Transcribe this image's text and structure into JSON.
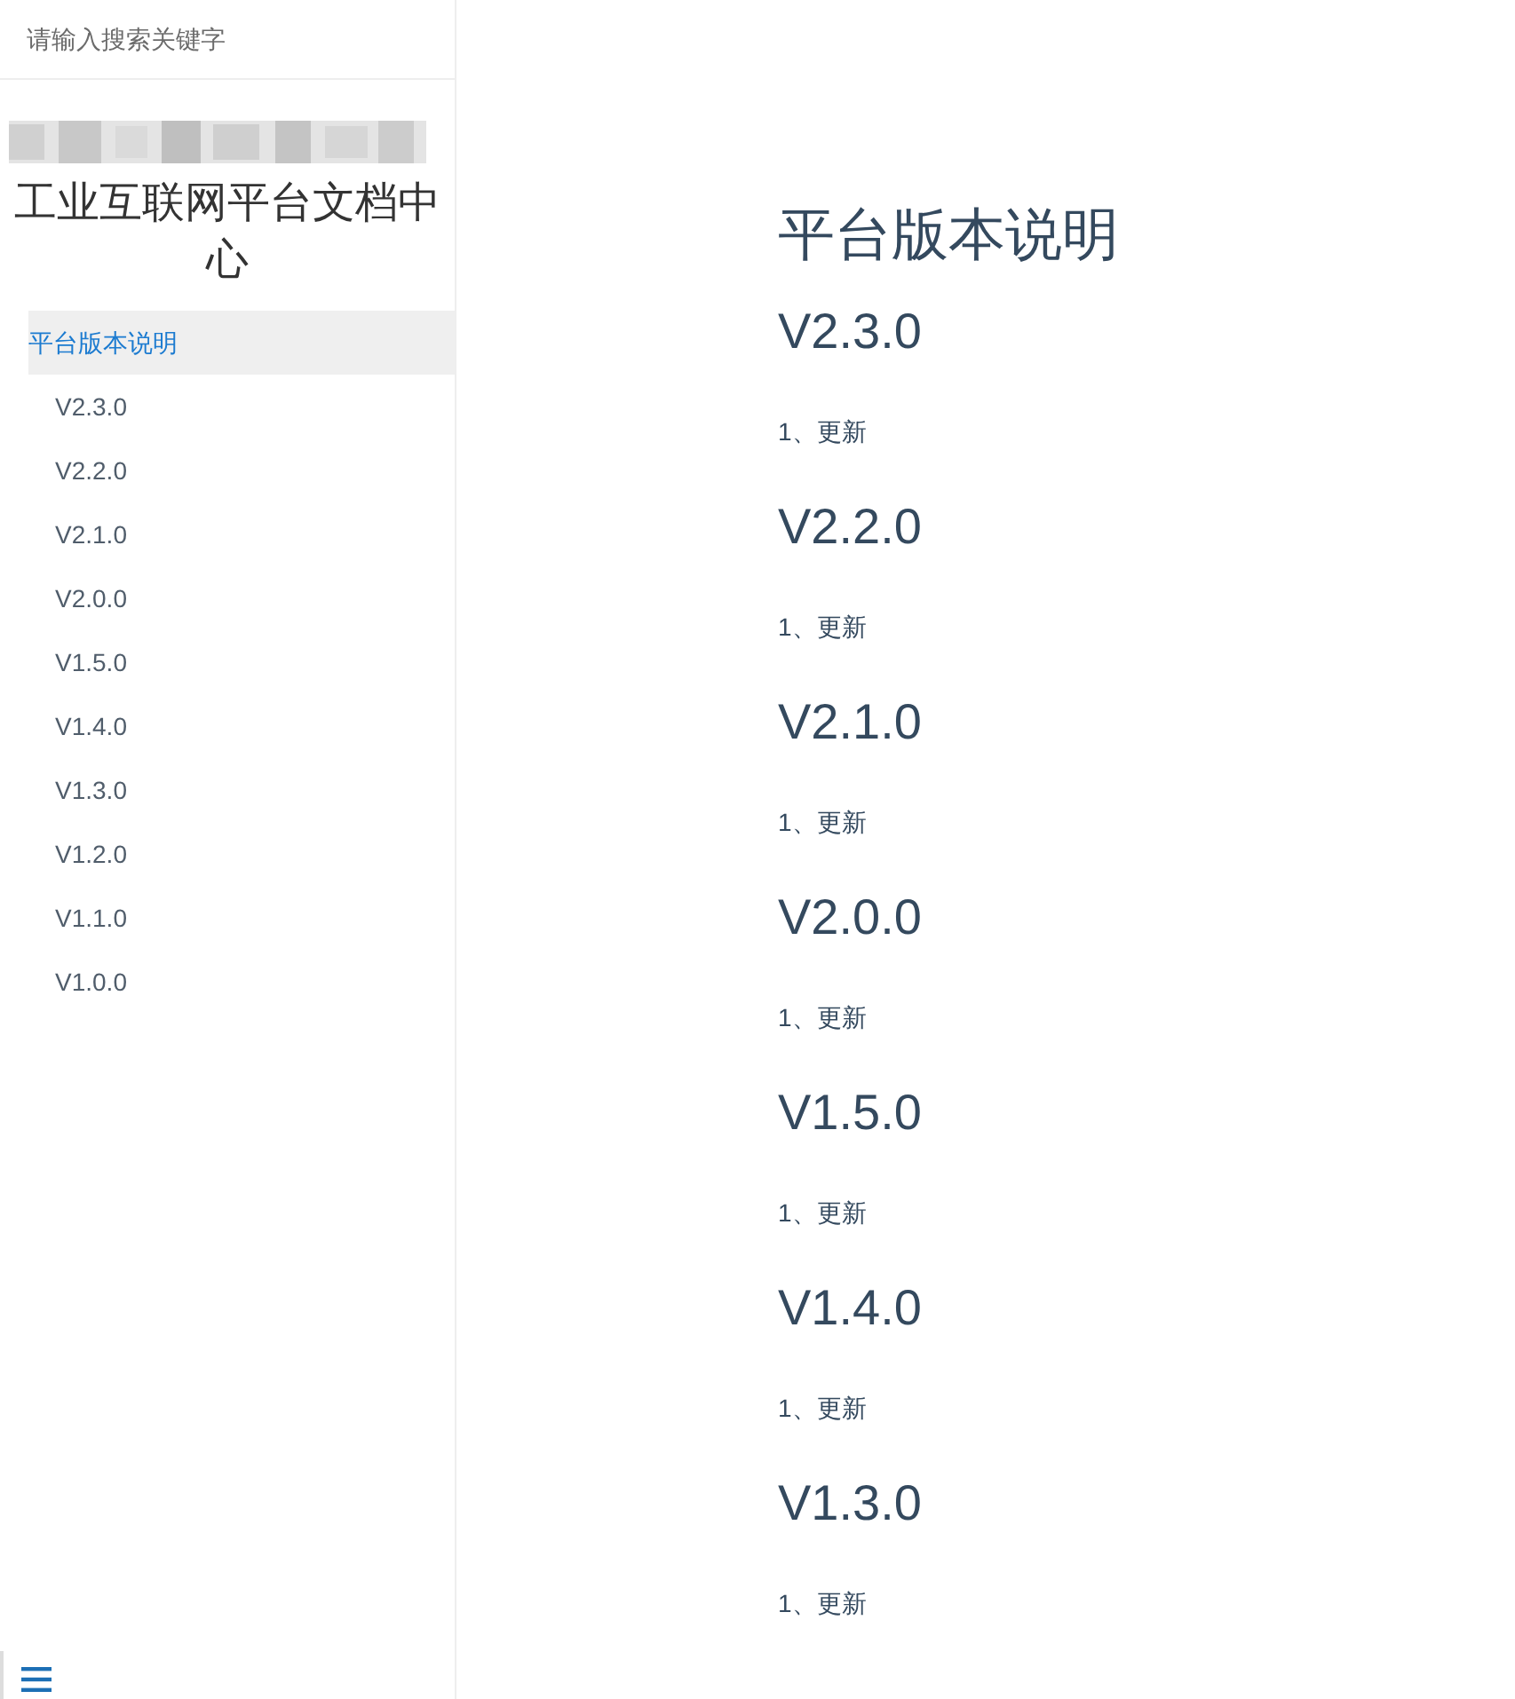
{
  "search": {
    "placeholder": "请输入搜索关键字"
  },
  "sidebar": {
    "title": "工业互联网平台文档中心",
    "items": [
      {
        "label": "平台版本说明",
        "selected": true,
        "children": [
          {
            "label": "V2.3.0",
            "selected": false
          },
          {
            "label": "V2.2.0",
            "selected": false
          },
          {
            "label": "V2.1.0",
            "selected": false
          },
          {
            "label": "V2.0.0",
            "selected": false
          },
          {
            "label": "V1.5.0",
            "selected": false
          },
          {
            "label": "V1.4.0",
            "selected": false
          },
          {
            "label": "V1.3.0",
            "selected": false
          },
          {
            "label": "V1.2.0",
            "selected": false
          },
          {
            "label": "V1.1.0",
            "selected": false
          },
          {
            "label": "V1.0.0",
            "selected": false
          }
        ]
      }
    ]
  },
  "content": {
    "title": "平台版本说明",
    "sections": [
      {
        "heading": "V2.3.0",
        "text": "1、更新"
      },
      {
        "heading": "V2.2.0",
        "text": "1、更新"
      },
      {
        "heading": "V2.1.0",
        "text": "1、更新"
      },
      {
        "heading": "V2.0.0",
        "text": "1、更新"
      },
      {
        "heading": "V1.5.0",
        "text": "1、更新"
      },
      {
        "heading": "V1.4.0",
        "text": "1、更新"
      },
      {
        "heading": "V1.3.0",
        "text": "1、更新"
      }
    ]
  }
}
